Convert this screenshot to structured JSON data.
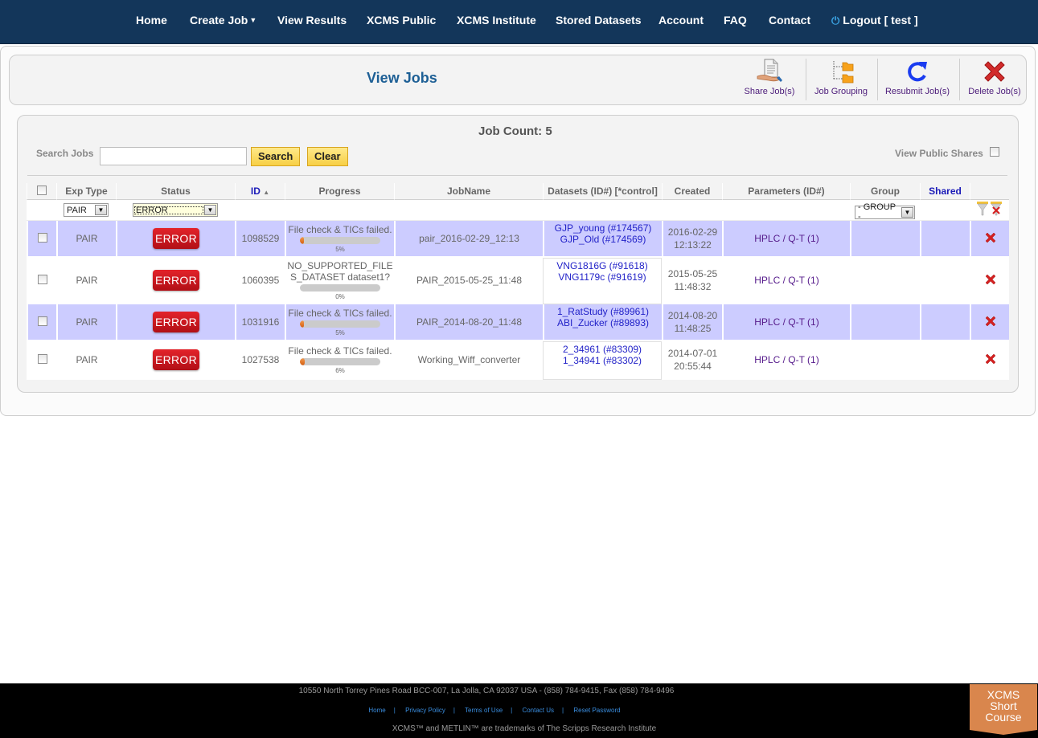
{
  "nav": {
    "items": [
      {
        "label": "Home"
      },
      {
        "label": "Create Job",
        "dropdown": true
      },
      {
        "label": "View Results"
      },
      {
        "label": "XCMS Public"
      },
      {
        "label": "XCMS Institute"
      },
      {
        "label": "Stored Datasets"
      },
      {
        "label": "Account"
      },
      {
        "label": "FAQ"
      },
      {
        "label": "Contact"
      }
    ],
    "logout": "Logout [ test ]",
    "icons": {
      "dropdown": "caret-down-icon",
      "logout": "power-icon"
    }
  },
  "header": {
    "title": "View Jobs",
    "tools": [
      {
        "label": "Share Job(s)",
        "icon": "share-hand-document-icon"
      },
      {
        "label": "Job Grouping",
        "icon": "folder-tree-icon"
      },
      {
        "label": "Resubmit Job(s)",
        "icon": "refresh-icon"
      },
      {
        "label": "Delete Job(s)",
        "icon": "delete-x-icon"
      }
    ]
  },
  "jobs": {
    "count_label": "Job Count: 5",
    "search": {
      "label": "Search Jobs",
      "value": "",
      "placeholder": "",
      "search_button": "Search",
      "clear_button": "Clear"
    },
    "view_public_shares": {
      "label": "View Public Shares",
      "checked": false
    },
    "columns": [
      "",
      "Exp Type",
      "Status",
      "ID",
      "Progress",
      "JobName",
      "Datasets (ID#) [*control]",
      "Created",
      "Parameters (ID#)",
      "Group",
      "Shared",
      ""
    ],
    "sort": {
      "column": "ID",
      "direction": "ascending-indicator"
    },
    "filters": {
      "exp_type": "PAIR",
      "status": "ERROR",
      "group": "- GROUP -"
    },
    "filter_icons": [
      "filter-funnel-icon",
      "clear-filter-icon"
    ],
    "rows": [
      {
        "exp_type": "PAIR",
        "status": "ERROR",
        "id": "1098529",
        "progress_msg": "File check & TICs failed.",
        "progress_pct": 5,
        "progress_label": "5%",
        "job_name": "pair_2016-02-29_12:13",
        "datasets": [
          "GJP_young (#174567)",
          "GJP_Old (#174569)"
        ],
        "created_date": "2016-02-29",
        "created_time": "12:13:22",
        "parameters": "HPLC / Q-T (1)",
        "group": "",
        "shared": ""
      },
      {
        "exp_type": "PAIR",
        "status": "ERROR",
        "id": "1060395",
        "progress_msg": "NO_SUPPORTED_FILES_DATASET dataset1?",
        "progress_pct": 0,
        "progress_label": "0%",
        "job_name": "PAIR_2015-05-25_11:48",
        "datasets": [
          "VNG1816G (#91618)",
          "VNG1179c (#91619)"
        ],
        "created_date": "2015-05-25",
        "created_time": "11:48:32",
        "parameters": "HPLC / Q-T (1)",
        "group": "",
        "shared": ""
      },
      {
        "exp_type": "PAIR",
        "status": "ERROR",
        "id": "1031916",
        "progress_msg": "File check & TICs failed.",
        "progress_pct": 5,
        "progress_label": "5%",
        "job_name": "PAIR_2014-08-20_11:48",
        "datasets": [
          "1_RatStudy (#89961)",
          "ABI_Zucker (#89893)"
        ],
        "created_date": "2014-08-20",
        "created_time": "11:48:25",
        "parameters": "HPLC / Q-T (1)",
        "group": "",
        "shared": ""
      },
      {
        "exp_type": "PAIR",
        "status": "ERROR",
        "id": "1027538",
        "progress_msg": "File check & TICs failed.",
        "progress_pct": 6,
        "progress_label": "6%",
        "job_name": "Working_Wiff_converter",
        "datasets": [
          "2_34961 (#83309)",
          "1_34941 (#83302)"
        ],
        "created_date": "2014-07-01",
        "created_time": "20:55:44",
        "parameters": "HPLC / Q-T (1)",
        "group": "",
        "shared": ""
      }
    ]
  },
  "footer": {
    "address": "10550 North Torrey Pines Road BCC-007, La Jolla, CA 92037 USA - (858) 784-9415, Fax (858) 784-9496",
    "links": [
      "Home",
      "Privacy Policy",
      "Terms of Use",
      "Contact Us",
      "Reset Password"
    ],
    "trademark": "XCMS™ and METLIN™ are trademarks of The Scripps Research Institute",
    "short_course": [
      "XCMS",
      "Short",
      "Course"
    ]
  },
  "colors": {
    "nav_bg": "#13365a",
    "row_highlight": "#ccccff",
    "error_red": "#c8161d",
    "title_blue": "#1d5f95",
    "progress_orange": "#e0711f",
    "short_course_orange": "#d9864d"
  }
}
